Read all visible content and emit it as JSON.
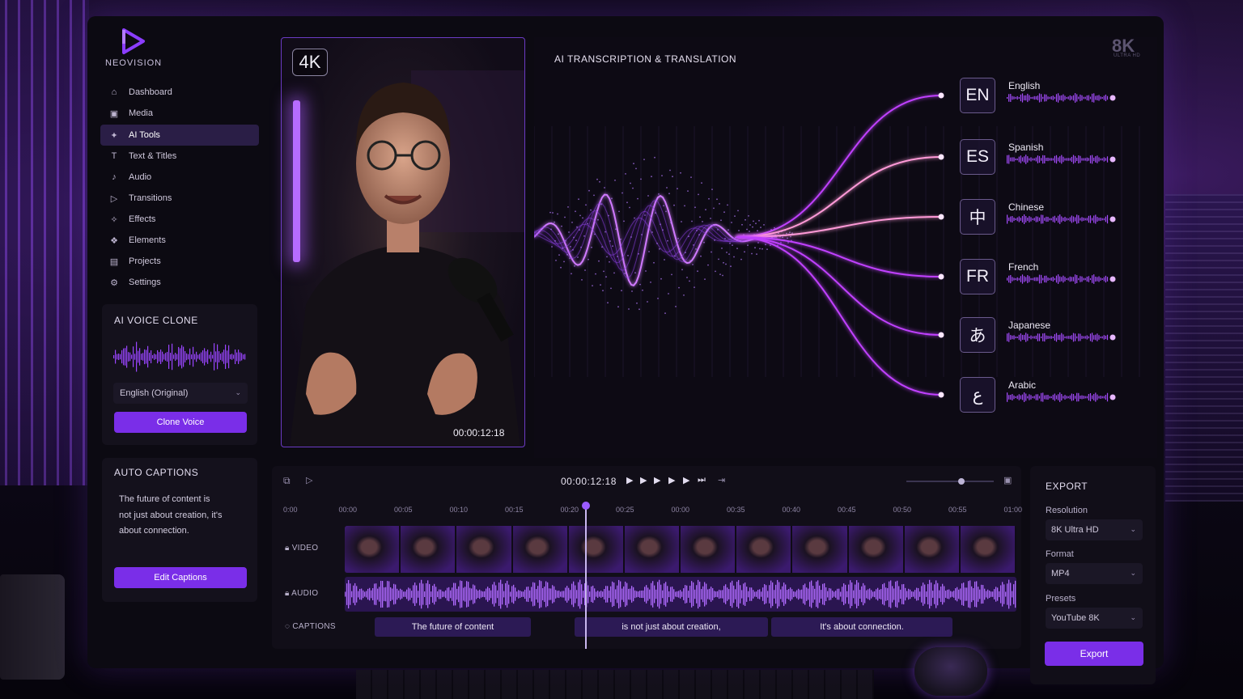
{
  "app": {
    "name": "NEOVISION"
  },
  "sidebar": {
    "items": [
      {
        "label": "Dashboard",
        "icon": "home-icon"
      },
      {
        "label": "Media",
        "icon": "image-icon"
      },
      {
        "label": "AI Tools",
        "icon": "ai-icon",
        "active": true
      },
      {
        "label": "Text & Titles",
        "icon": "text-icon"
      },
      {
        "label": "Audio",
        "icon": "music-icon"
      },
      {
        "label": "Transitions",
        "icon": "transition-icon"
      },
      {
        "label": "Effects",
        "icon": "effects-icon"
      },
      {
        "label": "Elements",
        "icon": "elements-icon"
      },
      {
        "label": "Projects",
        "icon": "folder-icon"
      },
      {
        "label": "Settings",
        "icon": "gear-icon"
      }
    ]
  },
  "voice_clone": {
    "title": "AI VOICE CLONE",
    "language": "English (Original)",
    "button": "Clone Voice"
  },
  "auto_captions": {
    "title": "AUTO CAPTIONS",
    "text": "The future of content is not just about creation, it's about connection.",
    "button": "Edit Captions"
  },
  "preview": {
    "quality_badge": "4K",
    "timecode": "00:00:12:18"
  },
  "translation": {
    "title": "AI TRANSCRIPTION & TRANSLATION",
    "badge": "8K",
    "badge_sub": "ULTRA HD",
    "languages": [
      {
        "code": "EN",
        "name": "English"
      },
      {
        "code": "ES",
        "name": "Spanish"
      },
      {
        "code": "中",
        "name": "Chinese"
      },
      {
        "code": "FR",
        "name": "French"
      },
      {
        "code": "あ",
        "name": "Japanese"
      },
      {
        "code": "ع",
        "name": "Arabic"
      }
    ],
    "colors": {
      "accent": "#c040ff",
      "warm": "#ff9ad8"
    }
  },
  "timeline": {
    "timecode": "00:00:12:18",
    "ruler": [
      "0:00",
      "00:00",
      "00:05",
      "00:10",
      "00:15",
      "00:20",
      "00:25",
      "00:00",
      "00:35",
      "00:40",
      "00:45",
      "00:50",
      "00:55",
      "01:00"
    ],
    "tracks": {
      "video": "VIDEO",
      "audio": "AUDIO",
      "captions": "CAPTIONS"
    },
    "caption_chips": [
      "The future of content",
      "is not just about creation,",
      "It's about connection."
    ],
    "clip_count": 12
  },
  "export": {
    "title": "EXPORT",
    "resolution_label": "Resolution",
    "resolution": "8K Ultra HD",
    "format_label": "Format",
    "format": "MP4",
    "presets_label": "Presets",
    "preset": "YouTube 8K",
    "button": "Export"
  }
}
